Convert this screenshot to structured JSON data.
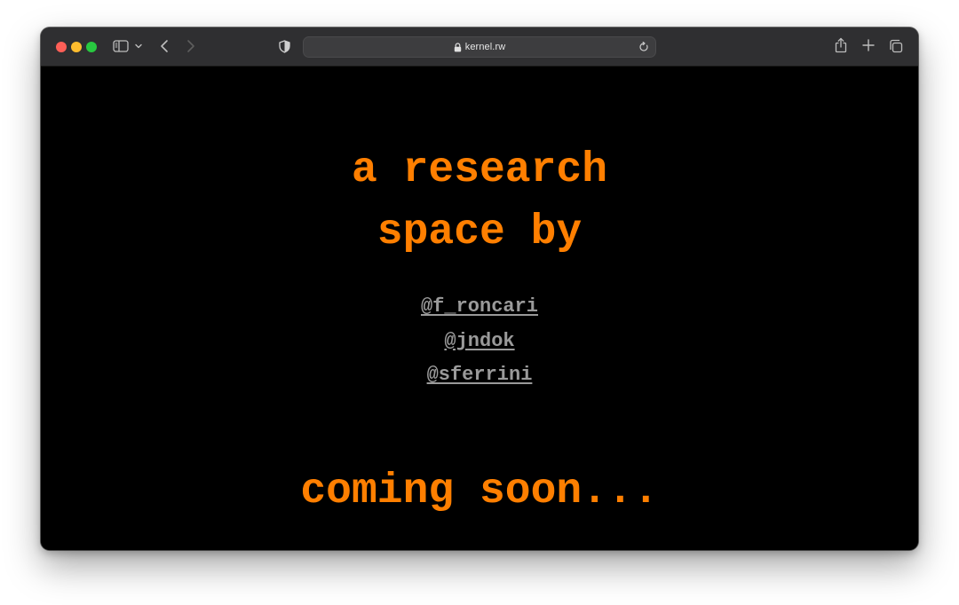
{
  "browser": {
    "url": "kernel.rw",
    "icons": {
      "sidebar": "sidebar-icon",
      "back": "chevron-left-icon",
      "forward": "chevron-right-icon",
      "privacy": "shield-icon",
      "lock": "lock-icon",
      "reload": "reload-icon",
      "share": "share-icon",
      "new_tab": "plus-icon",
      "tabs": "tabs-overview-icon"
    }
  },
  "page": {
    "headline_line1": "a research",
    "headline_line2": "space by",
    "handles": [
      "@f_roncari",
      "@jndok",
      "@sferrini"
    ],
    "coming_soon": "coming soon...",
    "colors": {
      "accent": "#ff7f00",
      "background": "#000000",
      "link": "#9a9a9a"
    }
  }
}
